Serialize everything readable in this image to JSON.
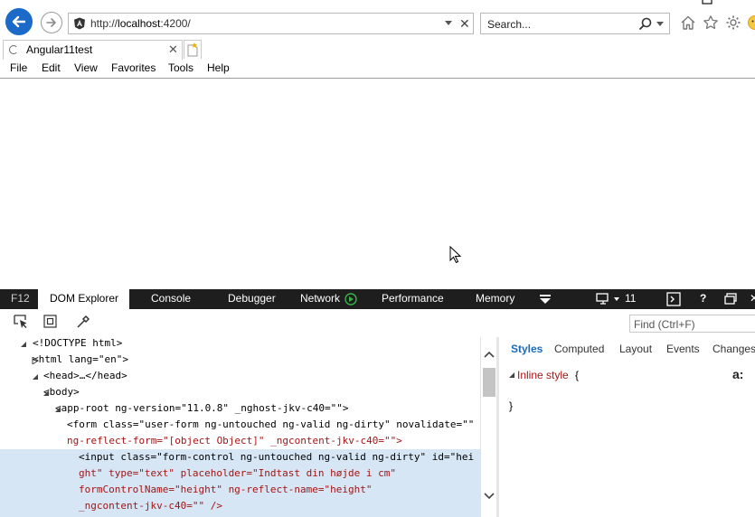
{
  "browser": {
    "url_prefix": "http://",
    "url_host": "localhost",
    "url_rest": ":4200/",
    "search_placeholder": "Search...",
    "tab_title": "Angular11test"
  },
  "menu": [
    "File",
    "Edit",
    "View",
    "Favorites",
    "Tools",
    "Help"
  ],
  "devtools": {
    "f12": "F12",
    "tabs": [
      "DOM Explorer",
      "Console",
      "Debugger",
      "Network",
      "Performance",
      "Memory"
    ],
    "emulation_version": "11",
    "find_placeholder": "Find (Ctrl+F)",
    "dom_lines": [
      "<!DOCTYPE html>",
      "<html lang=\"en\">",
      "<head>…</head>",
      "<body>",
      "<app-root ng-version=\"11.0.8\" _nghost-jkv-c40=\"\">",
      "<form class=\"user-form ng-untouched ng-valid ng-dirty\" novalidate=\"\"",
      "ng-reflect-form=\"[object Object]\" _ngcontent-jkv-c40=\"\">",
      "<input class=\"form-control ng-untouched ng-valid ng-dirty\" id=\"hei",
      "ght\" type=\"text\" placeholder=\"Indtast din højde i cm\"",
      "formControlName=\"height\" ng-reflect-name=\"height\"",
      "_ngcontent-jkv-c40=\"\" />"
    ],
    "style_tabs": [
      "Styles",
      "Computed",
      "Layout",
      "Events",
      "Changes"
    ],
    "inline_style_label": "Inline style",
    "open_brace": "{",
    "close_brace": "}",
    "font_toggle": "a:"
  }
}
